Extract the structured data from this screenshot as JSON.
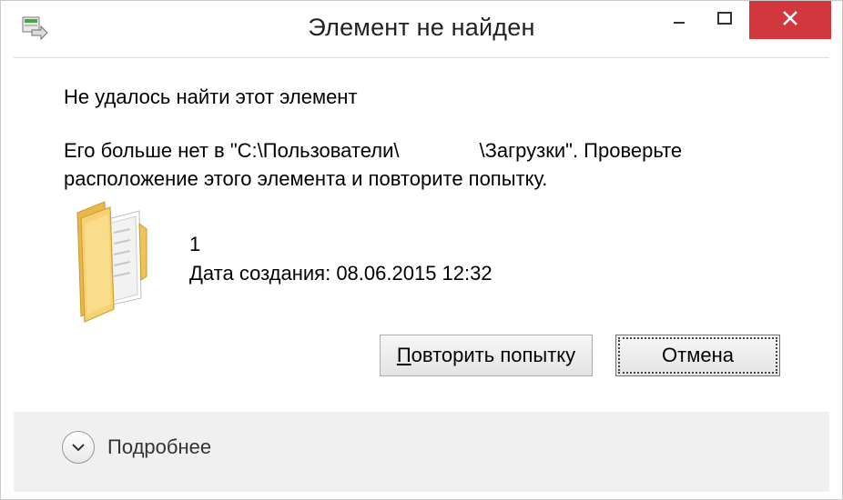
{
  "window": {
    "title": "Элемент не найден",
    "controls": {
      "minimize_icon": "minimize-icon",
      "maximize_icon": "maximize-icon",
      "close_icon": "close-icon"
    },
    "close_color": "#d3373e"
  },
  "dialog": {
    "headline": "Не удалось найти этот элемент",
    "message_line1_a": "Его больше нет в \"C:\\Пользователи\\",
    "message_line1_b": "\\Загрузки\". Проверьте",
    "message_line2": "расположение этого элемента и повторите попытку.",
    "item": {
      "icon": "folder-icon",
      "name": "1",
      "created": "Дата создания: 08.06.2015 12:32"
    },
    "buttons": {
      "retry_underlined": "П",
      "retry_rest": "овторить попытку",
      "cancel": "Отмена"
    }
  },
  "footer": {
    "details_label": "Подробнее",
    "details_icon": "chevron-down-icon"
  }
}
